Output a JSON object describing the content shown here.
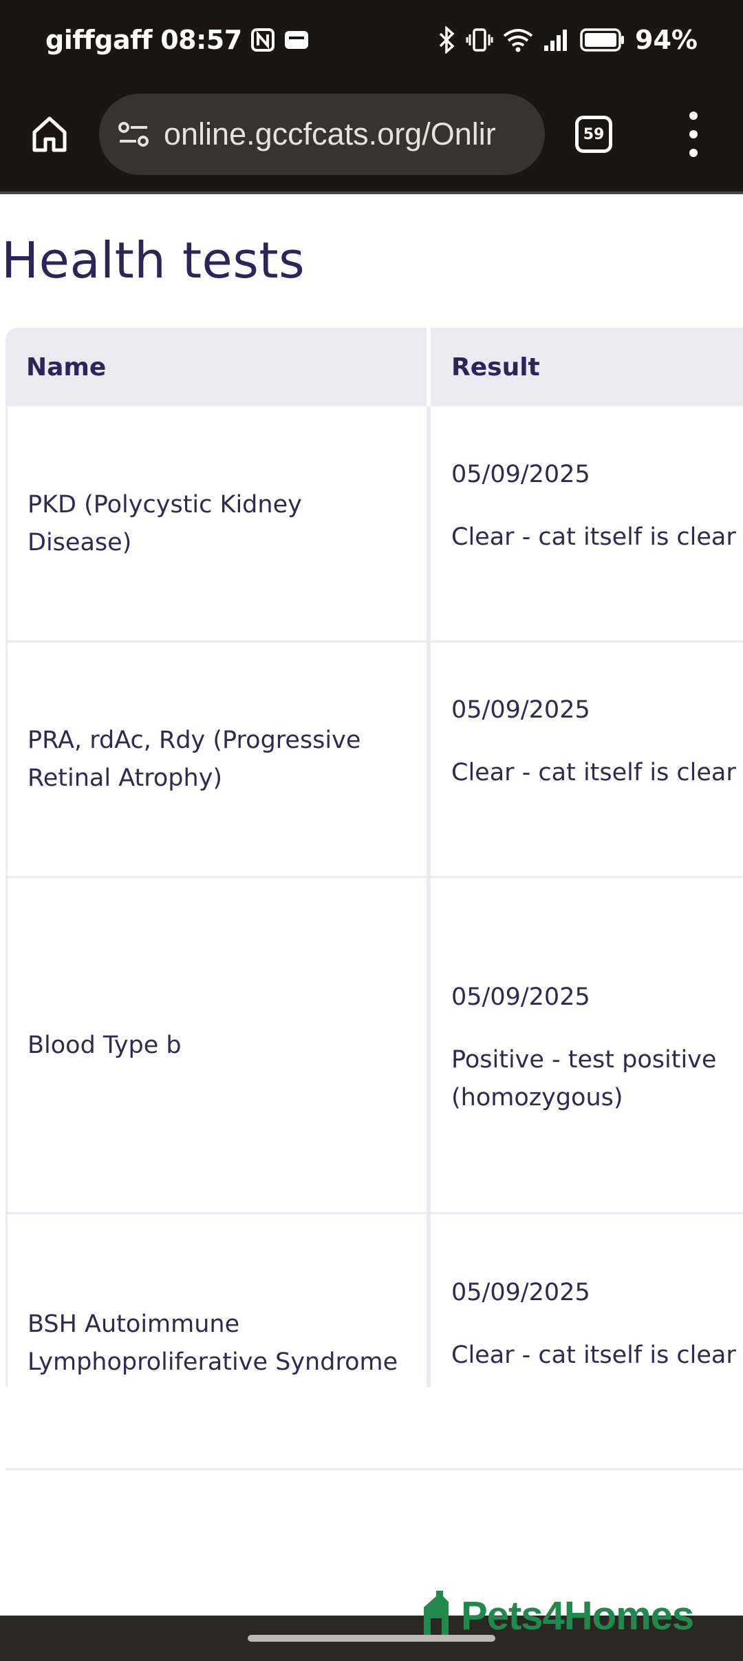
{
  "status_bar": {
    "carrier": "giffgaff",
    "time": "08:57",
    "battery": "94%"
  },
  "browser": {
    "url": "online.gccfcats.org/Onlir",
    "tab_count": "59"
  },
  "page": {
    "title": "Health tests"
  },
  "table": {
    "headers": {
      "name": "Name",
      "result": "Result"
    },
    "rows": [
      {
        "name": "PKD (Polycystic Kidney Disease)",
        "date": "05/09/2025",
        "result": "Clear - cat itself is clear"
      },
      {
        "name": "PRA, rdAc, Rdy (Progressive Retinal Atrophy)",
        "date": "05/09/2025",
        "result": "Clear - cat itself is clear"
      },
      {
        "name": "Blood Type b",
        "date": "05/09/2025",
        "result": "Positive - test positive (homozygous)"
      },
      {
        "name": "BSH Autoimmune Lymphoproliferative Syndrome",
        "date": "05/09/2025",
        "result": "Clear - cat itself is clear"
      }
    ]
  },
  "watermark": {
    "text": "Pets4Homes",
    "color": "#1f8a4c"
  },
  "colors": {
    "chrome": "#1c1612",
    "heading": "#2b2558",
    "header_bg": "#ebe9f2"
  }
}
